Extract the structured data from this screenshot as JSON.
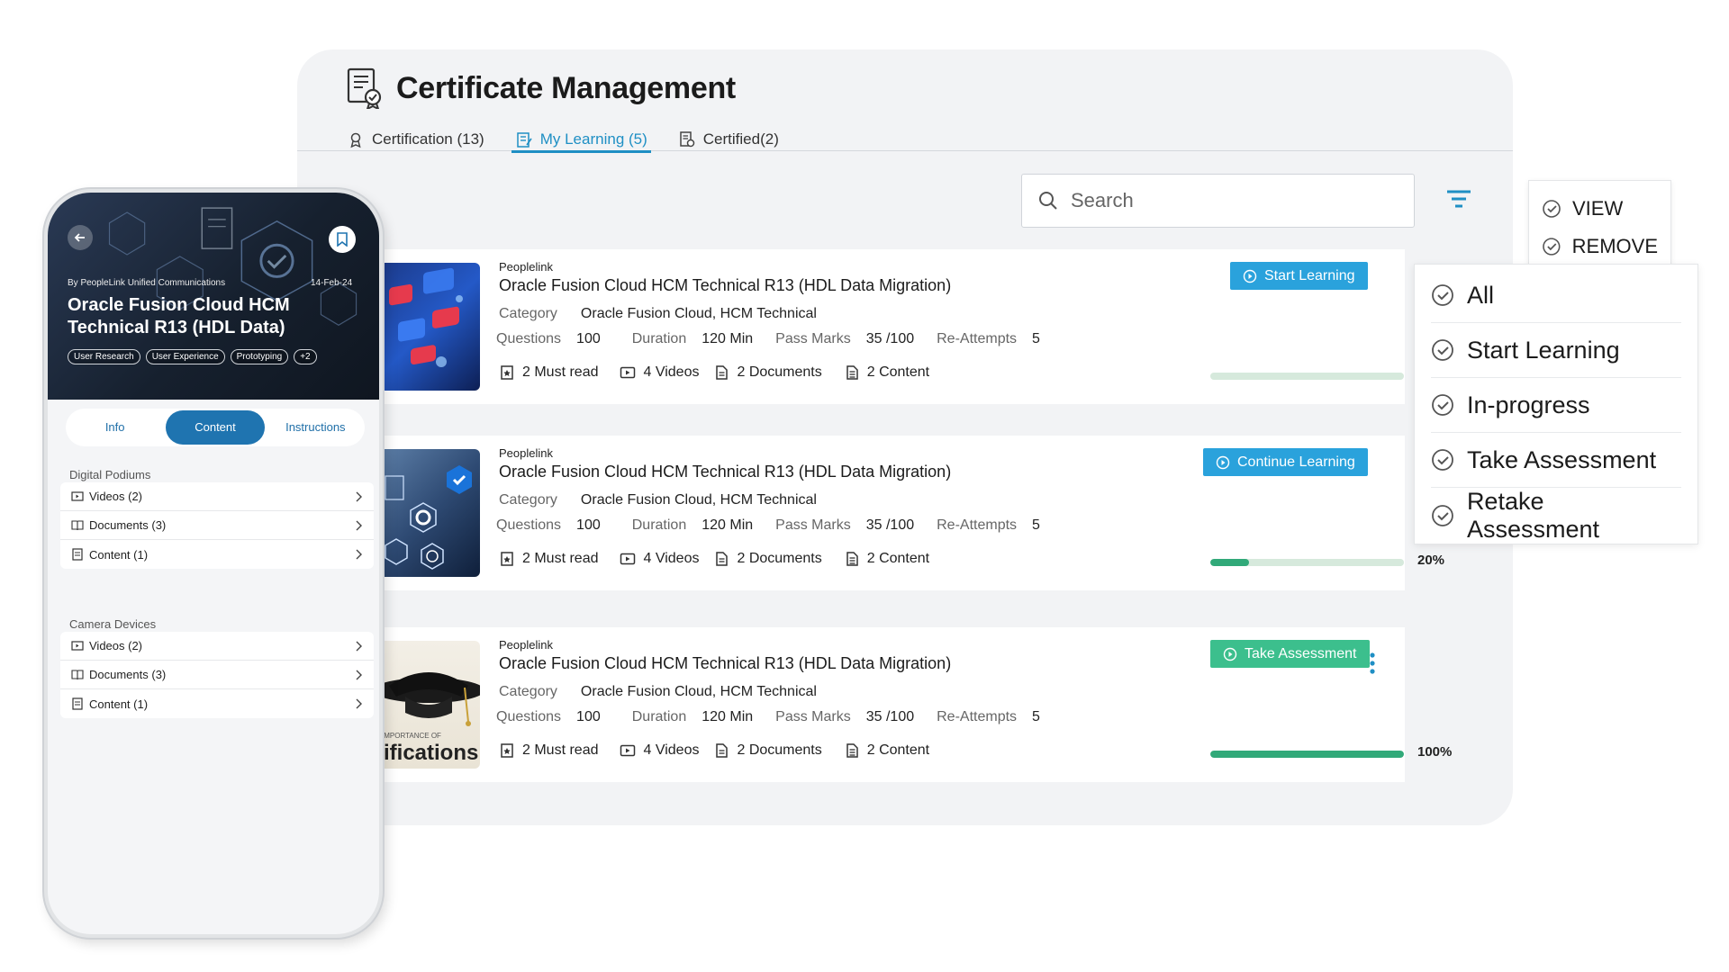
{
  "panel": {
    "title": "Certificate Management",
    "tabs": [
      {
        "label": "Certification (13)",
        "icon": "ribbon-icon",
        "active": false
      },
      {
        "label": "My Learning (5)",
        "icon": "notebook-icon",
        "active": true
      },
      {
        "label": "Certified(2)",
        "icon": "certificate-icon",
        "active": false
      }
    ],
    "search": {
      "placeholder": "Search",
      "icon": "search-icon"
    },
    "filter_icon": "filter-icon"
  },
  "cards": [
    {
      "brand": "Peoplelink",
      "title": "Oracle Fusion Cloud HCM Technical R13 (HDL Data Migration)",
      "category_label": "Category",
      "category": "Oracle Fusion Cloud, HCM Technical",
      "questions_label": "Questions",
      "questions": "100",
      "duration_label": "Duration",
      "duration": "120 Min",
      "pass_label": "Pass Marks",
      "pass": "35 /100",
      "reattempts_label": "Re-Attempts",
      "reattempts": "5",
      "must_read": "2 Must read",
      "videos": "4 Videos",
      "documents": "2 Documents",
      "content": "2 Content",
      "action": "Start Learning",
      "action_color": "#2aa2dc",
      "progress": 0,
      "percent": ""
    },
    {
      "brand": "Peoplelink",
      "title": "Oracle Fusion Cloud HCM Technical R13 (HDL Data Migration)",
      "category_label": "Category",
      "category": "Oracle Fusion Cloud, HCM Technical",
      "questions_label": "Questions",
      "questions": "100",
      "duration_label": "Duration",
      "duration": "120 Min",
      "pass_label": "Pass Marks",
      "pass": "35 /100",
      "reattempts_label": "Re-Attempts",
      "reattempts": "5",
      "must_read": "2 Must read",
      "videos": "4 Videos",
      "documents": "2 Documents",
      "content": "2 Content",
      "action": "Continue Learning",
      "action_color": "#2aa2dc",
      "progress": 20,
      "percent": "20%"
    },
    {
      "brand": "Peoplelink",
      "title": "Oracle Fusion Cloud HCM Technical R13 (HDL Data Migration)",
      "category_label": "Category",
      "category": "Oracle Fusion Cloud, HCM Technical",
      "questions_label": "Questions",
      "questions": "100",
      "duration_label": "Duration",
      "duration": "120 Min",
      "pass_label": "Pass Marks",
      "pass": "35 /100",
      "reattempts_label": "Re-Attempts",
      "reattempts": "5",
      "must_read": "2 Must read",
      "videos": "4 Videos",
      "documents": "2 Documents",
      "content": "2 Content",
      "action": "Take Assessment",
      "action_color": "#3cbf8d",
      "progress": 100,
      "percent": "100%",
      "thumb_text": "IMPORTANCE OF",
      "thumb_text2": "tifications"
    }
  ],
  "context_menu": [
    {
      "label": "VIEW"
    },
    {
      "label": "REMOVE"
    }
  ],
  "filter_menu": [
    {
      "label": "All"
    },
    {
      "label": "Start Learning"
    },
    {
      "label": "In-progress"
    },
    {
      "label": "Take Assessment"
    },
    {
      "label": "Retake Assessment"
    }
  ],
  "phone": {
    "by": "By  PeopleLink Unified Communications",
    "date": "14-Feb-24",
    "title": "Oracle Fusion Cloud HCM Technical R13 (HDL Data)",
    "chips": [
      "User Research",
      "User Experience",
      "Prototyping",
      "+2"
    ],
    "segments": [
      {
        "label": "Info",
        "active": false
      },
      {
        "label": "Content",
        "active": true
      },
      {
        "label": "Instructions",
        "active": false
      }
    ],
    "sections": [
      {
        "title": "Digital Podiums",
        "rows": [
          {
            "label": "Videos  (2)",
            "icon": "video-icon"
          },
          {
            "label": "Documents  (3)",
            "icon": "book-icon"
          },
          {
            "label": "Content  (1)",
            "icon": "content-icon"
          }
        ]
      },
      {
        "title": "Camera Devices",
        "rows": [
          {
            "label": "Videos  (2)",
            "icon": "video-icon"
          },
          {
            "label": "Documents  (3)",
            "icon": "book-icon"
          },
          {
            "label": "Content  (1)",
            "icon": "content-icon"
          }
        ]
      }
    ]
  },
  "colors": {
    "accent": "#1f8fc4",
    "primary_button": "#2aa2dc",
    "success_button": "#3cbf8d",
    "progress": "#31a979"
  }
}
